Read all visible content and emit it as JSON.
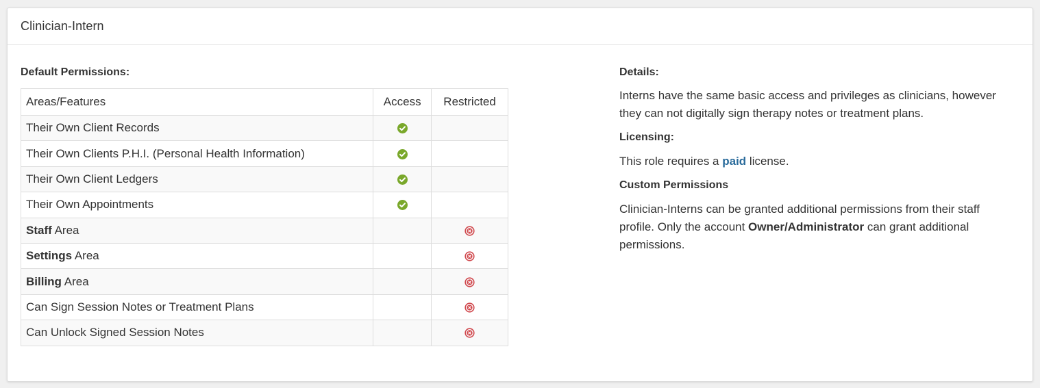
{
  "panel": {
    "title": "Clinician-Intern"
  },
  "permissions": {
    "label": "Default Permissions:",
    "headers": {
      "area": "Areas/Features",
      "access": "Access",
      "restricted": "Restricted"
    },
    "rows": [
      {
        "bold": "",
        "text": "Their Own Client Records",
        "status": "access"
      },
      {
        "bold": "",
        "text": "Their Own Clients P.H.I. (Personal Health Information)",
        "status": "access"
      },
      {
        "bold": "",
        "text": "Their Own Client Ledgers",
        "status": "access"
      },
      {
        "bold": "",
        "text": "Their Own Appointments",
        "status": "access"
      },
      {
        "bold": "Staff",
        "text": " Area",
        "status": "restricted"
      },
      {
        "bold": "Settings",
        "text": " Area",
        "status": "restricted"
      },
      {
        "bold": "Billing",
        "text": " Area",
        "status": "restricted"
      },
      {
        "bold": "",
        "text": "Can Sign Session Notes or Treatment Plans",
        "status": "restricted"
      },
      {
        "bold": "",
        "text": "Can Unlock Signed Session Notes",
        "status": "restricted"
      }
    ],
    "icons": {
      "access": "check-circle-icon",
      "restricted": "x-circle-icon"
    },
    "colors": {
      "access": "#7aa82b",
      "restricted": "#d0474c"
    }
  },
  "details": {
    "label": "Details:",
    "text": "Interns have the same basic access and privileges as clinicians, however they can not digitally sign therapy notes or treatment plans."
  },
  "licensing": {
    "label": "Licensing:",
    "prefix": "This role requires a ",
    "link": "paid",
    "suffix": " license.",
    "link_color": "#2a6b9b"
  },
  "custom": {
    "label": "Custom Permissions",
    "text_1": "Clinician-Interns can be granted additional permissions from their staff profile. Only the account ",
    "bold": "Owner/Administrator",
    "text_2": " can grant additional permissions."
  }
}
